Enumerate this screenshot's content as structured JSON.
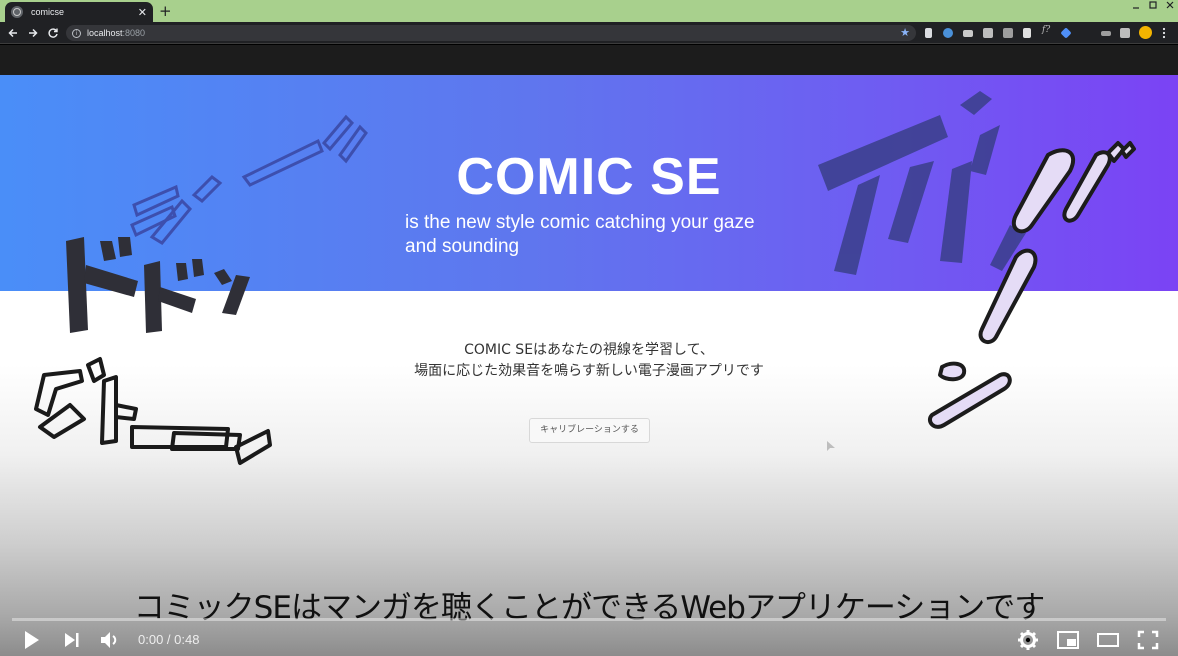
{
  "browser": {
    "tab_title": "comicse",
    "tab_close": "✕",
    "new_tab": "+",
    "url_host": "localhost",
    "url_port": ":8080"
  },
  "hero": {
    "title": "COMIC SE",
    "subtitle_line1": "is the new style comic catching your gaze",
    "subtitle_line2": "and sounding"
  },
  "description": {
    "line1": "COMIC SEはあなたの視線を学習して、",
    "line2": "場面に応じた効果音を鳴らす新しい電子漫画アプリです"
  },
  "calibrate_button": "キャリブレーションする",
  "caption": "コミックSEはマンガを聴くことができるWebアプリケーションです",
  "player": {
    "time_current": "0:00",
    "time_sep": " / ",
    "time_total": "0:48",
    "progress": 0
  },
  "icons": {
    "back": "arrow-left-icon",
    "forward": "arrow-right-icon",
    "reload": "reload-icon",
    "bookmark": "star-icon",
    "play": "play-icon",
    "next": "next-icon",
    "volume": "volume-icon",
    "settings": "gear-icon",
    "miniplayer": "miniplayer-icon",
    "theater": "theater-icon",
    "fullscreen": "fullscreen-icon"
  },
  "colors": {
    "tabstrip": "#a8d08d",
    "hero_start": "#4a8ef8",
    "hero_end": "#7b43f4"
  }
}
